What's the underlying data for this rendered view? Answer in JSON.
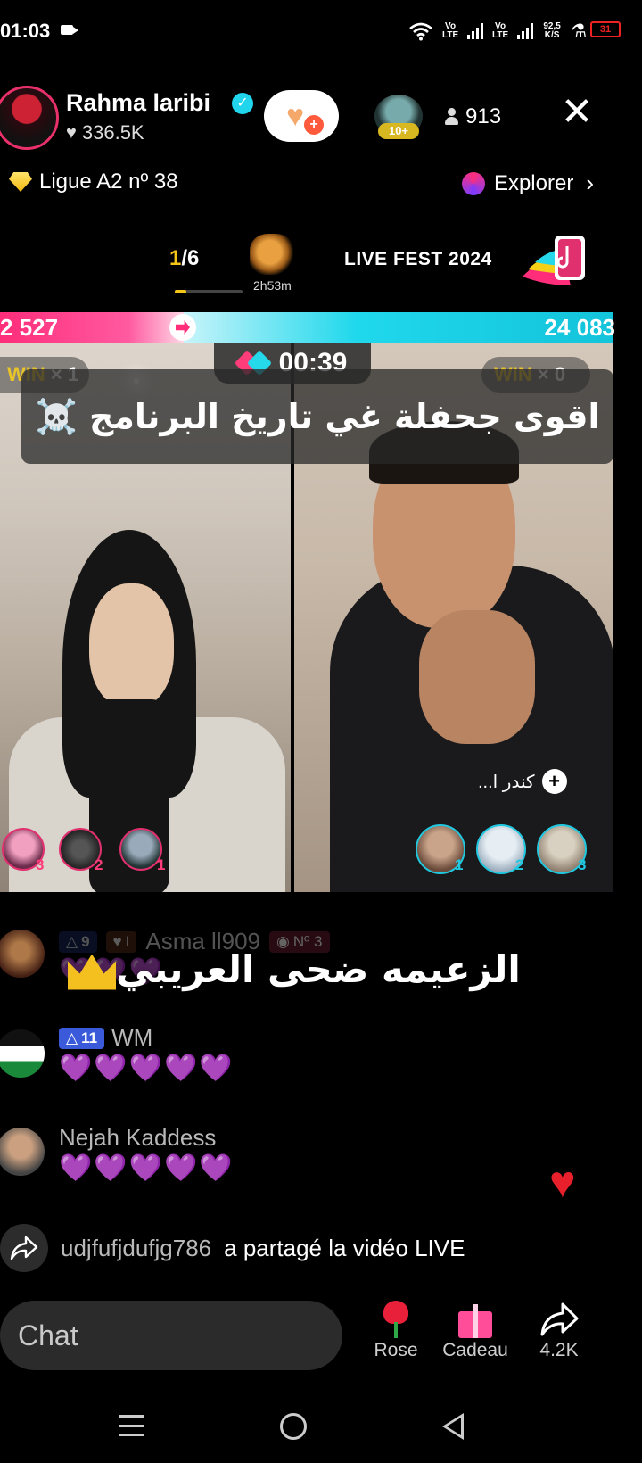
{
  "status_bar": {
    "time": "01:03",
    "net_label_1": "Vo LTE",
    "net_label_2": "Vo LTE",
    "speed": "92,5 K/S",
    "battery": "31"
  },
  "host": {
    "name": "Rahma laribi",
    "likes": "336.5K",
    "top_gifter_badge": "10+",
    "viewer_count": "913"
  },
  "league": {
    "label": "Ligue A2 nº 38",
    "explorer_label": "Explorer"
  },
  "fest": {
    "count_current": "1",
    "count_total": "/6",
    "timer": "2h53m",
    "title": "LIVE FEST 2024",
    "progress_fraction": 0.17
  },
  "battle": {
    "score_left": "2 527",
    "score_right": "24 083",
    "timer": "00:39",
    "win_label": "WIN",
    "win_left": "× 1",
    "win_right": "× 0",
    "caption": "اقوى جحفلة غي تاريخ البرنامج ☠️",
    "left_gifters": [
      "3",
      "2",
      "1"
    ],
    "right_gifters": [
      "1",
      "2",
      "3"
    ],
    "cohost_tag": "كندر ا..."
  },
  "chat": {
    "messages": [
      {
        "level": "9",
        "fan_level": "I",
        "name": "Asma ll909",
        "rank": "Nº 3",
        "text": "💜💜💜"
      },
      {
        "level": "11",
        "name": "WM",
        "text": "💜💜💜💜💜"
      },
      {
        "name": "Nejah Kaddess",
        "text": "💜💜💜💜💜"
      }
    ],
    "overlay_text": "الزعيمه ضحى العريبي",
    "share_user": "udjfufjdufjg786",
    "share_text": "a partagé la vidéo LIVE"
  },
  "bottom": {
    "chat_placeholder": "Chat",
    "rose_label": "Rose",
    "gift_label": "Cadeau",
    "share_count": "4.2K"
  },
  "colors": {
    "accent_pink": "#ff2d7a",
    "accent_cyan": "#20d8ec",
    "win_gold": "#e8c42a",
    "level_blue": "#3a5ad9"
  },
  "icons": {
    "status_recording": "video-camera-icon",
    "wifi": "wifi-icon",
    "verified": "verified-check-icon",
    "follow": "heart-plus-icon",
    "viewers": "person-icon",
    "close": "close-icon",
    "league": "diamond-icon",
    "explore": "explore-orb-icon",
    "fest_mascot": "lion-icon",
    "battle": "battle-versus-icon",
    "share": "share-arrow-icon",
    "rose": "rose-icon",
    "gift": "gift-icon",
    "nav_menu": "menu-icon",
    "nav_home": "home-circle-icon",
    "nav_back": "back-triangle-icon"
  }
}
